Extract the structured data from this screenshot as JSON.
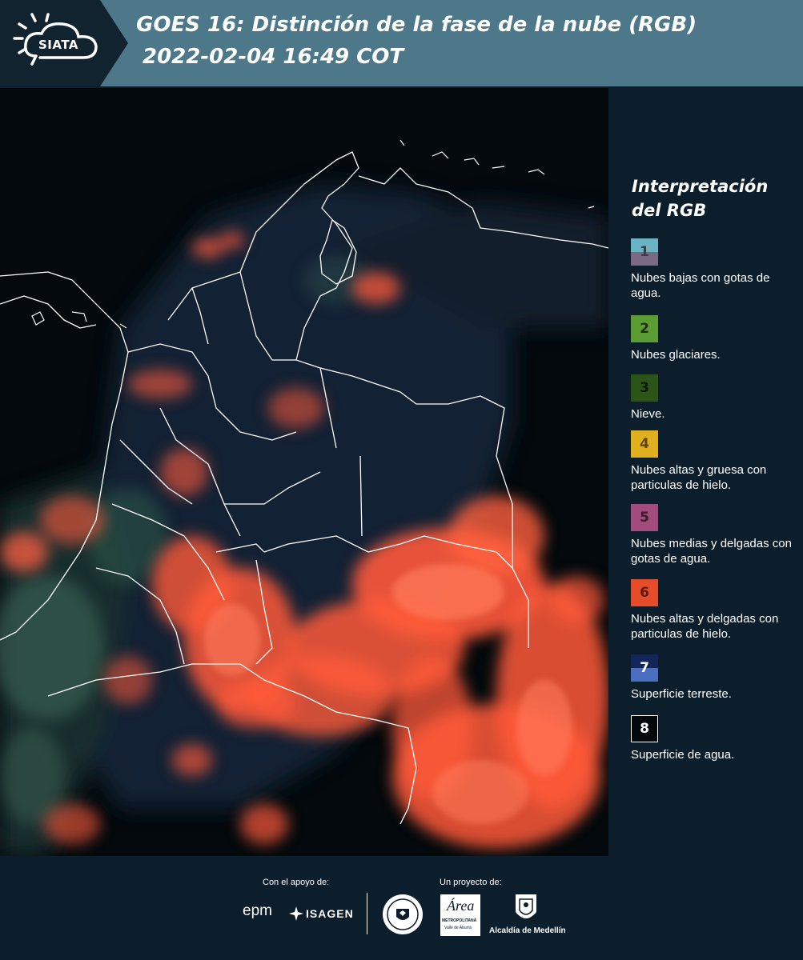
{
  "header": {
    "logo_text": "SIATA",
    "title_line1": "GOES 16: Distinción de la fase de la nube (RGB)",
    "title_line2": "2022-02-04 16:49 COT"
  },
  "legend": {
    "title_line1": "Interpretación",
    "title_line2": "del RGB",
    "items": [
      {
        "num": "1",
        "label": "Nubes bajas con gotas de agua.",
        "color_top": "#6ab3c2",
        "color_bottom": "#7a6a84",
        "num_color": "#3a3a4a"
      },
      {
        "num": "2",
        "label": "Nubes glaciares.",
        "color_top": "#5c9c34",
        "color_bottom": "#5c9c34",
        "num_color": "#1d2f12"
      },
      {
        "num": "3",
        "label": "Nieve.",
        "color_top": "#2c5418",
        "color_bottom": "#2c5418",
        "num_color": "#0e1a08"
      },
      {
        "num": "4",
        "label": "Nubes altas y gruesa con particulas de hielo.",
        "color_top": "#e0b020",
        "color_bottom": "#e0b020",
        "num_color": "#5a4708"
      },
      {
        "num": "5",
        "label": "Nubes medias y delgadas con gotas de agua.",
        "color_top": "#a24c7c",
        "color_bottom": "#a24c7c",
        "num_color": "#3c1a2c"
      },
      {
        "num": "6",
        "label": "Nubes altas y delgadas con particulas de hielo.",
        "color_top": "#e44c2a",
        "color_bottom": "#e44c2a",
        "num_color": "#5a1a0c"
      },
      {
        "num": "7",
        "label": "Superficie terreste.",
        "color_top": "#12265a",
        "color_bottom": "#4a6ec0",
        "num_color": "#ffffff"
      },
      {
        "num": "8",
        "label": "Superficie de agua.",
        "color_top": "#03090a",
        "color_bottom": "#03090a",
        "num_color": "#ffffff"
      }
    ]
  },
  "footer": {
    "support_label": "Con el apoyo de:",
    "project_label": "Un proyecto de:",
    "epm": "epm",
    "isagen": "ISAGEN",
    "area_metro": "Área",
    "area_metro_sub": "METROPOLITANA",
    "area_metro_sub2": "Valle de Aburrá",
    "alcaldia": "Alcaldía de Medellín"
  },
  "colors": {
    "header_bg": "#4d7889",
    "page_bg": "#0c1e2b",
    "cloud_ice": "#ff5a3a"
  }
}
